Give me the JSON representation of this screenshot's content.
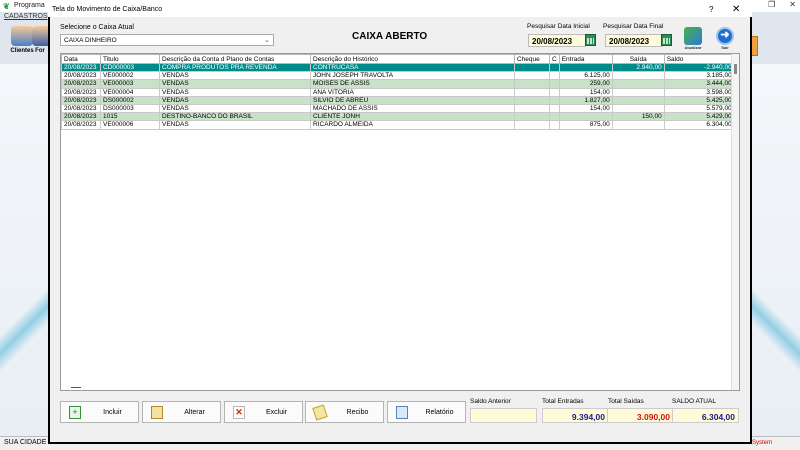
{
  "background": {
    "app_title": "Programa",
    "menu": "CADASTROS",
    "toolbar": [
      {
        "label": "Clientes",
        "icon": "people-icon"
      },
      {
        "label": "For",
        "icon": "supplier-icon"
      }
    ],
    "status_city": "SUA CIDADE -",
    "status_right": "System"
  },
  "dialog": {
    "title": "Tela do Movimento de Caixa/Banco",
    "help": "?",
    "close": "✕",
    "caixa_label": "Selecione o Caixa Atual",
    "caixa_value": "CAIXA DINHEIRO",
    "heading": "CAIXA ABERTO",
    "date_ini_label": "Pesquisar Data Inicial",
    "date_ini": "20/08/2023",
    "date_fin_label": "Pesquisar Data Final",
    "date_fin": "20/08/2023",
    "refresh_caption": "Atualizar",
    "go_caption": "Sair"
  },
  "table": {
    "columns": [
      "Data",
      "Titulo",
      "Descrição da Conta d Plano de Contas",
      "Descrição do Histórico",
      "Cheque",
      "C",
      "Entrada",
      "Saída",
      "Saldo"
    ],
    "rows": [
      [
        "20/08/2023",
        "CD000003",
        "COMPRA PRODUTOS PRA REVENDA",
        "CONTRUCASA",
        "",
        "",
        "",
        "2.940,00",
        "-2.940,00"
      ],
      [
        "20/08/2023",
        "VE000002",
        "VENDAS",
        "JOHN JOSEPH TRAVOLTA",
        "",
        "",
        "6.125,00",
        "",
        "3.185,00"
      ],
      [
        "20/08/2023",
        "VE000003",
        "VENDAS",
        "MOISES DE ASSIS",
        "",
        "",
        "259,00",
        "",
        "3.444,00"
      ],
      [
        "20/08/2023",
        "VE000004",
        "VENDAS",
        "ANA VITÓRIA",
        "",
        "",
        "154,00",
        "",
        "3.598,00"
      ],
      [
        "20/08/2023",
        "DS000002",
        "VENDAS",
        "SILVIO DE ABREU",
        "",
        "",
        "1.827,00",
        "",
        "5.425,00"
      ],
      [
        "20/08/2023",
        "DS000003",
        "VENDAS",
        "MACHADO DE ASSIS",
        "",
        "",
        "154,00",
        "",
        "5.579,00"
      ],
      [
        "20/08/2023",
        "1015",
        "DESTINO-BANCO DO BRASIL",
        "CLIENTE JONH",
        "",
        "",
        "",
        "150,00",
        "5.429,00"
      ],
      [
        "20/08/2023",
        "VE000006",
        "VENDAS",
        "RICARDO ALMEIDA",
        "",
        "",
        "875,00",
        "",
        "6.304,00"
      ]
    ]
  },
  "buttons": {
    "incluir": "Incluir",
    "alterar": "Alterar",
    "excluir": "Excluir",
    "recibo": "Recibo",
    "relatorio": "Relatório"
  },
  "totals": {
    "saldo_anterior_label": "Saldo Anterior",
    "saldo_anterior": "",
    "entradas_label": "Total Entradas",
    "entradas": "9.394,00",
    "saidas_label": "Total Saídas",
    "saidas": "3.090,00",
    "saldo_atual_label": "SALDO ATUAL",
    "saldo_atual": "6.304,00"
  },
  "colors": {
    "selected_row": "#008b8b",
    "alt_row": "#c7e2c7",
    "input_bg": "#fffbd8",
    "saidas": "#d01010",
    "entradas": "#1a1a8c"
  }
}
